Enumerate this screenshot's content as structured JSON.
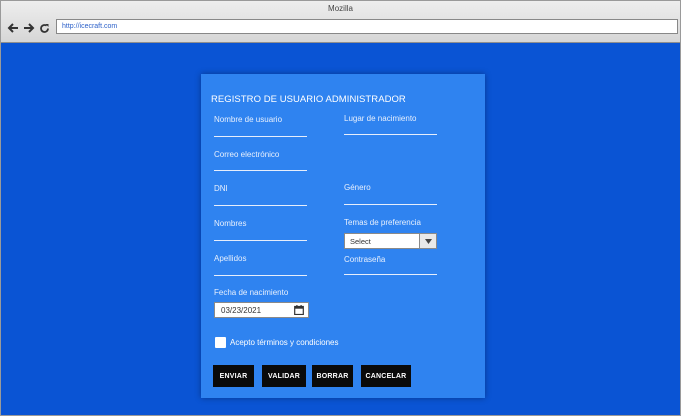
{
  "browser": {
    "title": "Mozilla",
    "url": "http://icecraft.com"
  },
  "form": {
    "title": "REGISTRO DE USUARIO ADMINISTRADOR",
    "fields": {
      "username": {
        "label": "Nombre de usuario"
      },
      "birthplace": {
        "label": "Lugar de nacimiento"
      },
      "email": {
        "label": "Correo electrónico"
      },
      "dni": {
        "label": "DNI"
      },
      "gender": {
        "label": "Género"
      },
      "names": {
        "label": "Nombres"
      },
      "topics": {
        "label": "Temas de preferencia",
        "selected": "Select"
      },
      "surnames": {
        "label": "Apellidos"
      },
      "password": {
        "label": "Contraseña"
      },
      "birthdate": {
        "label": "Fecha de nacimiento",
        "value": "03/23/2021"
      }
    },
    "terms": {
      "label": "Acepto términos y condiciones",
      "checked": false
    },
    "buttons": {
      "submit": "ENVIAR",
      "validate": "VALIDAR",
      "clear": "BORRAR",
      "cancel": "CANCELAR"
    }
  },
  "colors": {
    "page_background": "#0a54d4",
    "card_background": "#2f83f0",
    "button_background": "#0a0a0a"
  },
  "icons": [
    "back-arrow-icon",
    "forward-arrow-icon",
    "reload-icon",
    "chevron-down-icon",
    "calendar-icon"
  ]
}
